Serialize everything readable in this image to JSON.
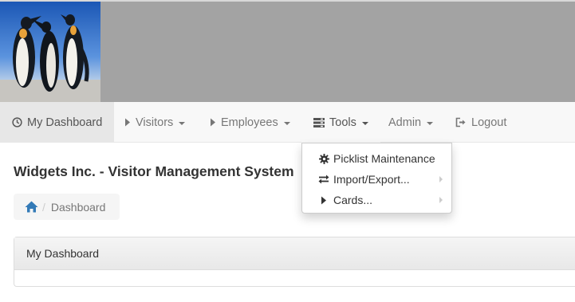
{
  "app": {
    "logo_alt": "penguins"
  },
  "navbar": {
    "items": [
      {
        "label": "My Dashboard",
        "icon": "dashboard-icon",
        "active": true
      },
      {
        "label": "Visitors",
        "icon": "play-icon",
        "has_caret": true
      },
      {
        "label": "Employees",
        "icon": "play-icon",
        "has_caret": true
      },
      {
        "label": "Tools",
        "icon": "tasks-icon",
        "has_caret": true,
        "open": true
      },
      {
        "label": "Admin",
        "has_caret": true
      },
      {
        "label": "Logout",
        "icon": "logout-icon"
      }
    ]
  },
  "tools_menu": {
    "items": [
      {
        "label": "Picklist Maintenance",
        "icon": "gear-icon"
      },
      {
        "label": "Import/Export...",
        "icon": "transfer-icon",
        "submenu": true
      },
      {
        "label": "Cards...",
        "icon": "play-icon",
        "submenu": true
      }
    ]
  },
  "page": {
    "title": "Widgets Inc. - Visitor Management System"
  },
  "breadcrumb": {
    "home_icon": "home-icon",
    "current": "Dashboard"
  },
  "panel": {
    "heading": "My Dashboard"
  },
  "colors": {
    "banner": "#a3a3a3",
    "navbar_bg": "#f8f8f8",
    "active_tab": "#e7e7e7",
    "link": "#337ab7"
  }
}
